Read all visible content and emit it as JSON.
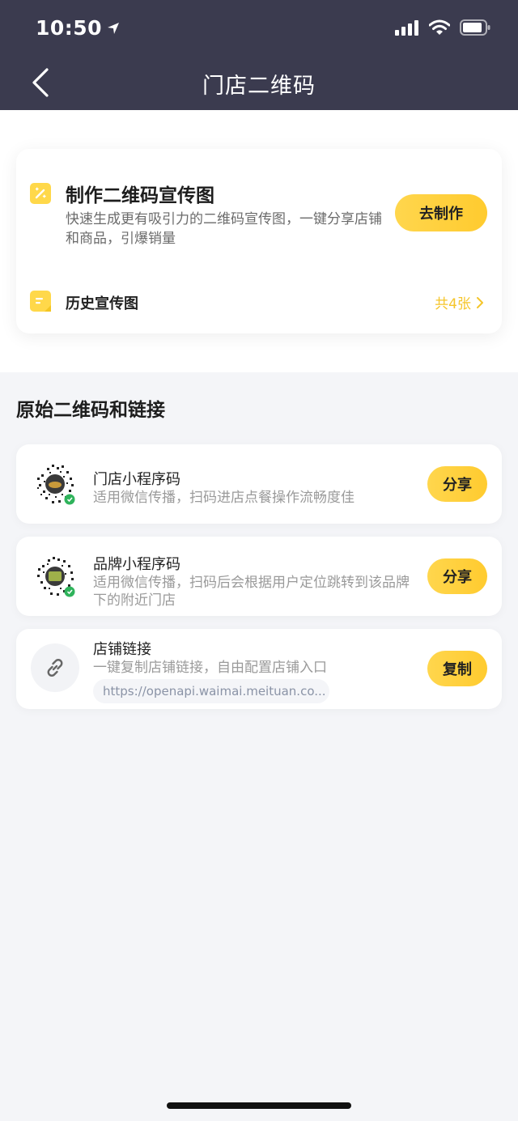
{
  "status_bar": {
    "time": "10:50"
  },
  "nav": {
    "title": "门店二维码"
  },
  "make_card": {
    "title": "制作二维码宣传图",
    "desc": "快速生成更有吸引力的二维码宣传图，一键分享店铺和商品，引爆销量",
    "button": "去制作",
    "history_label": "历史宣传图",
    "history_count": "共4张"
  },
  "section": {
    "title": "原始二维码和链接"
  },
  "items": [
    {
      "title": "门店小程序码",
      "desc": "适用微信传播，扫码进店点餐操作流畅度佳",
      "button": "分享"
    },
    {
      "title": "品牌小程序码",
      "desc": "适用微信传播，扫码后会根据用户定位跳转到该品牌下的附近门店",
      "button": "分享"
    },
    {
      "title": "店铺链接",
      "desc": "一键复制店铺链接，自由配置店铺入口",
      "url": "https://openapi.waimai.meituan.co...",
      "button": "复制"
    }
  ],
  "colors": {
    "header_bg": "#3b3b4f",
    "accent": "#ffd04a",
    "history_count": "#f5c52a",
    "wechat_green": "#2fb35b"
  }
}
